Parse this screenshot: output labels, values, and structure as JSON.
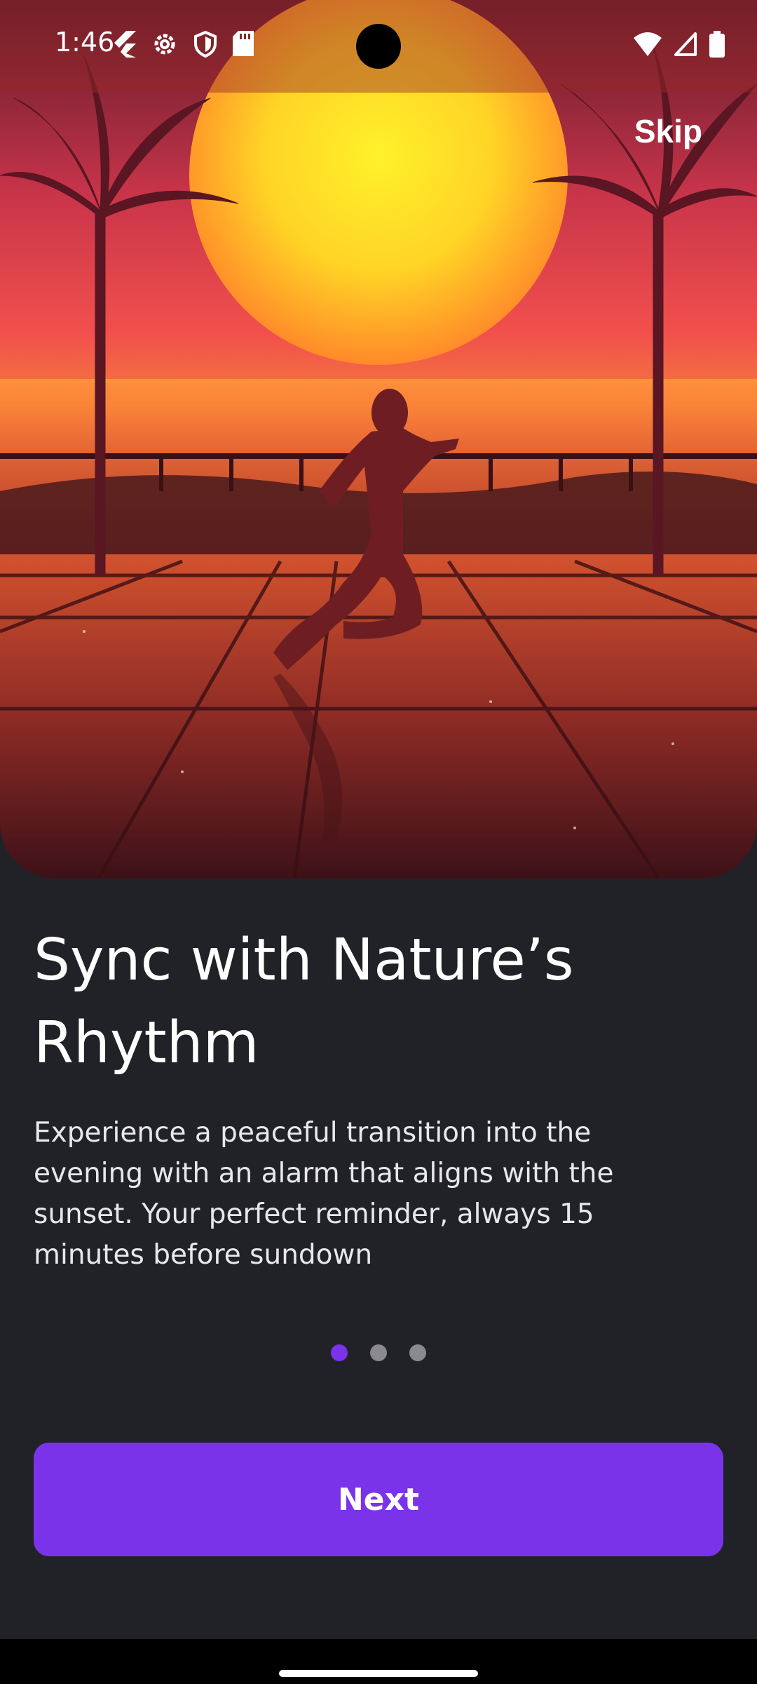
{
  "status_bar": {
    "time": "1:46",
    "left_icons": [
      "flutter-icon",
      "gear-icon",
      "shield-icon",
      "sd-card-icon"
    ],
    "right_icons": [
      "wifi-icon",
      "cellular-signal-icon",
      "battery-icon"
    ]
  },
  "header": {
    "skip_label": "Skip"
  },
  "onboarding": {
    "title": "Sync with Nature’s Rhythm",
    "description": "Experience a peaceful transition into the evening with an alarm that aligns with the sunset. Your perfect reminder, always 15 minutes before sundown",
    "page_count": 3,
    "current_page": 1,
    "next_label": "Next"
  },
  "colors": {
    "background": "#212227",
    "accent": "#7b33ea",
    "inactive_dot": "#8a8a8e"
  }
}
